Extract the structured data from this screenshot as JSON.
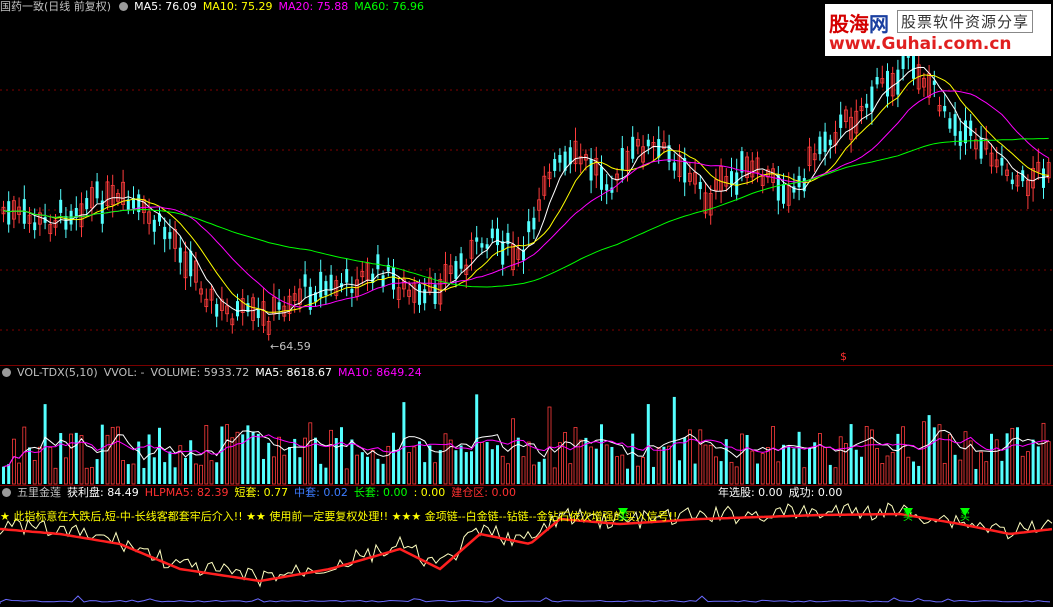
{
  "colors": {
    "background": "#000000",
    "bull_candle": "#ff3c3c",
    "bear_candle": "#54ffff",
    "ma5": "#ffffff",
    "ma10": "#ffff00",
    "ma20": "#ff00ff",
    "ma60": "#00ff00",
    "grid": "#800000"
  },
  "price": {
    "title": "国药一致(日线 前复权)",
    "ma5": "MA5: 76.09",
    "ma10": "MA10: 75.29",
    "ma20": "MA20: 75.88",
    "ma60": "MA60: 76.96",
    "low_label": "←64.59",
    "dollar_mark": "$"
  },
  "volume": {
    "name": "VOL-TDX(5,10)",
    "vvol": "VVOL: -",
    "volume": "VOLUME: 5933.72",
    "ma5": "MA5: 8618.67",
    "ma10": "MA10: 8649.24"
  },
  "indicator": {
    "name": "五里金莲",
    "profit": "获利盘: 84.49",
    "hlpma5": "HLPMA5: 82.39",
    "short": "短套: 0.77",
    "mid": "中套: 0.02",
    "long": "长套: 0.00",
    "extra": ": 0.00",
    "build": "建仓区: 0.00",
    "year_pick": "年选股: 0.00",
    "success": "成功: 0.00",
    "marquee": "★ 此指标意在大跌后,短-中-长线客都套牢后介入!! ★★ 使用前一定要复权处理!! ★★★ 金项链--白金链--钻链--金钻石依次增强的买入信号!!",
    "signals": [
      "买",
      "买",
      "买"
    ]
  },
  "watermark": {
    "brand_a": "股海",
    "brand_b": "网",
    "subtitle": "股票软件资源分享",
    "url": "www.Guhai.com.cn"
  },
  "chart_data": {
    "type": "candlestick",
    "low_annotation": 64.59,
    "ma_values": {
      "MA5": 76.09,
      "MA10": 75.29,
      "MA20": 75.88,
      "MA60": 76.96
    },
    "volume_values": {
      "VOLUME": 5933.72,
      "MA5": 8618.67,
      "MA10": 8649.24
    },
    "indicator_values": {
      "获利盘": 84.49,
      "HLPMA5": 82.39,
      "短套": 0.77,
      "中套": 0.02,
      "长套": 0.0,
      "建仓区": 0.0,
      "年选股": 0.0,
      "成功": 0.0
    }
  }
}
